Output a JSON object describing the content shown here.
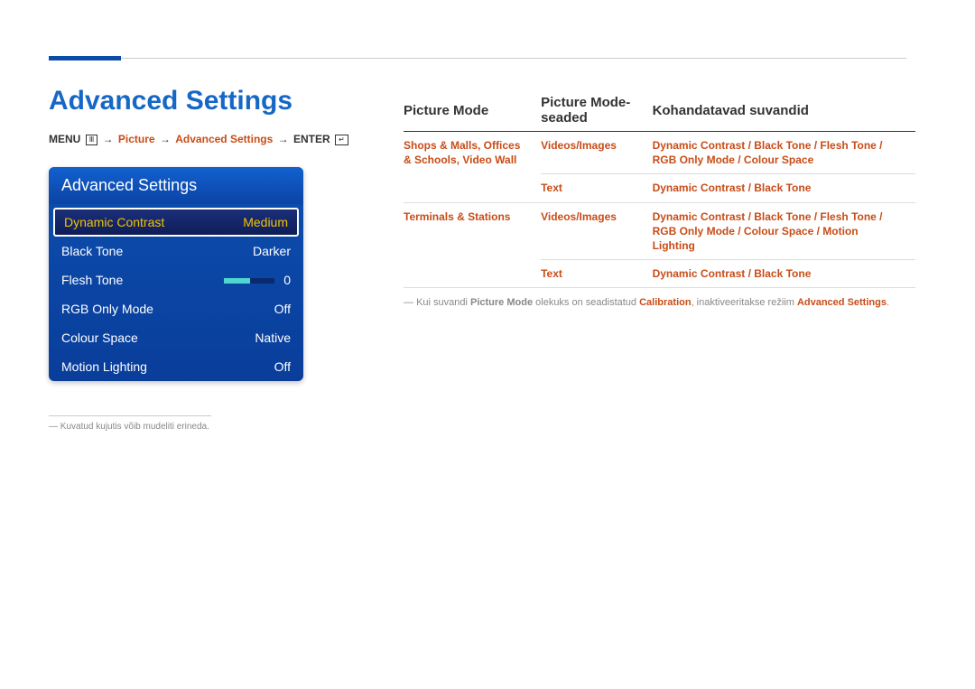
{
  "page_title": "Advanced Settings",
  "breadcrumb": {
    "menu_label": "MENU",
    "path1": "Picture",
    "path2": "Advanced Settings",
    "enter_label": "ENTER",
    "arrow": "→"
  },
  "panel": {
    "header": "Advanced Settings",
    "rows": [
      {
        "label": "Dynamic Contrast",
        "value": "Medium",
        "selected": true
      },
      {
        "label": "Black Tone",
        "value": "Darker"
      },
      {
        "label": "Flesh Tone",
        "value": "0",
        "slider": true
      },
      {
        "label": "RGB Only Mode",
        "value": "Off"
      },
      {
        "label": "Colour Space",
        "value": "Native"
      },
      {
        "label": "Motion Lighting",
        "value": "Off"
      }
    ]
  },
  "left_footnote": "Kuvatud kujutis võib mudeliti erineda.",
  "table": {
    "headers": [
      "Picture Mode",
      "Picture Mode-seaded",
      "Kohandatavad suvandid"
    ],
    "rows": [
      {
        "c1": "Shops & Malls, Offices & Schools, Video Wall",
        "c2": "Videos/Images",
        "c3": "Dynamic Contrast / Black Tone / Flesh Tone / RGB Only Mode / Colour Space"
      },
      {
        "c1": "",
        "c2": "Text",
        "c3": "Dynamic Contrast / Black Tone"
      },
      {
        "c1": "Terminals & Stations",
        "c2": "Videos/Images",
        "c3": "Dynamic Contrast / Black Tone / Flesh Tone / RGB Only Mode / Colour Space / Motion Lighting"
      },
      {
        "c1": "",
        "c2": "Text",
        "c3": "Dynamic Contrast / Black Tone"
      }
    ]
  },
  "note": {
    "pre": "Kui suvandi ",
    "b1": "Picture Mode",
    "mid": " olekuks on seadistatud ",
    "hl1": "Calibration",
    "mid2": ", inaktiveeritakse režiim ",
    "hl2": "Advanced Settings",
    "post": "."
  }
}
